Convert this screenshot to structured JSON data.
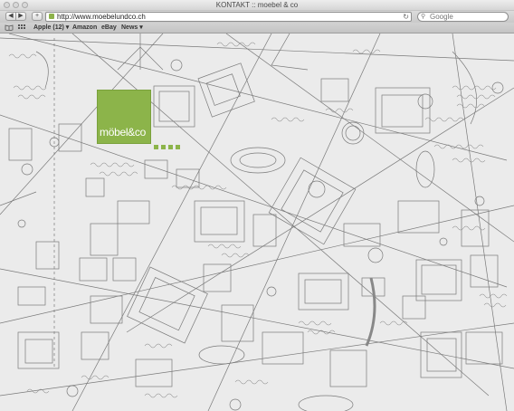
{
  "window": {
    "title": "KONTAKT :: moebel & co"
  },
  "toolbar": {
    "back_glyph": "◀",
    "forward_glyph": "▶",
    "add_glyph": "+",
    "url": "http://www.moebelundco.ch",
    "reload_glyph": "↻",
    "search_placeholder": "Google"
  },
  "bookmarks": {
    "items": [
      {
        "label": "Apple (12) ▾"
      },
      {
        "label": "Amazon"
      },
      {
        "label": "eBay"
      },
      {
        "label": "News ▾"
      }
    ],
    "icons": [
      "book-icon",
      "grid-icon"
    ]
  },
  "site": {
    "logo_text": "möbel&co",
    "logo_color": "#8cb44a",
    "background": "floor-plan-sketch"
  },
  "colors": {
    "accent": "#8cb44a",
    "sketch_line": "#7a7a7a",
    "background": "#ebebeb"
  }
}
